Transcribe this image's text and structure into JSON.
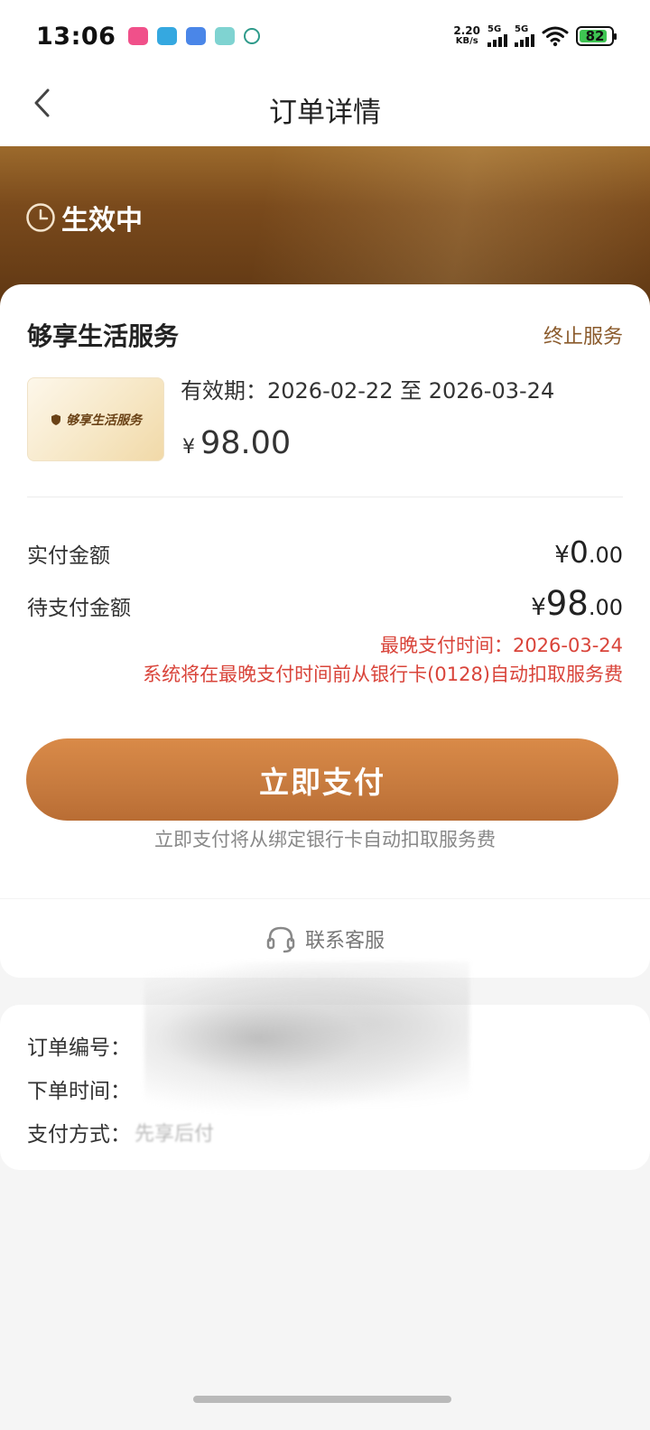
{
  "status_bar": {
    "time": "13:06",
    "net_speed_value": "2.20",
    "net_speed_unit": "KB/s",
    "sim1": "5G",
    "sim2": "5G",
    "battery": "82",
    "battery_level_percent": 82
  },
  "nav": {
    "title": "订单详情"
  },
  "hero": {
    "status": "生效中"
  },
  "service": {
    "name": "够享生活服务",
    "terminate_label": "终止服务",
    "thumb_text": "够享生活服务",
    "validity": "有效期：2026-02-22 至 2026-03-24",
    "price_symbol": "¥",
    "price": "98.00"
  },
  "payment": {
    "paid_label": "实付金额",
    "paid_symbol": "¥",
    "paid_int": "0",
    "paid_dec": ".00",
    "due_label": "待支付金额",
    "due_symbol": "¥",
    "due_int": "98",
    "due_dec": ".00",
    "deadline": "最晚支付时间：2026-03-24",
    "auto_debit_note": "系统将在最晚支付时间前从银行卡(0128)自动扣取服务费",
    "pay_button": "立即支付",
    "pay_note": "立即支付将从绑定银行卡自动扣取服务费"
  },
  "contact": {
    "label": "联系客服"
  },
  "order_info": {
    "order_no_label": "订单编号：",
    "order_time_label": "下单时间：",
    "pay_method_label": "支付方式：",
    "pay_method_value": "先享后付"
  },
  "colors": {
    "accent": "#c67a3e",
    "warning": "#d9443a",
    "terminate": "#8a5a2b"
  }
}
